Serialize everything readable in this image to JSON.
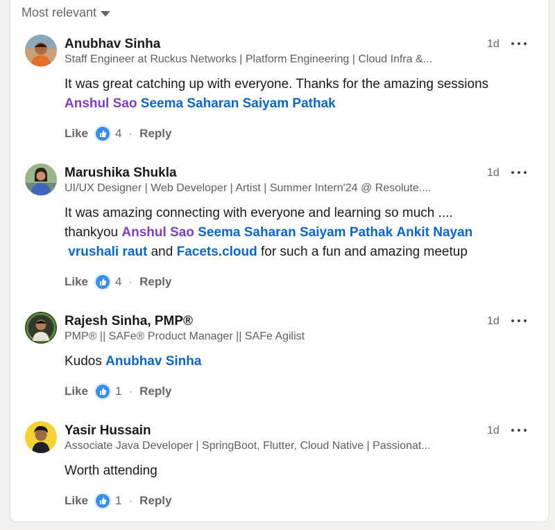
{
  "sort": {
    "label": "Most relevant"
  },
  "comments": [
    {
      "name": "Anubhav Sinha",
      "headline": "Staff Engineer at Ruckus Networks | Platform Engineering | Cloud Infra &...",
      "time": "1d",
      "text_1": "It was great catching up with everyone. Thanks for the amazing sessions",
      "mentions": [
        "Anshul Sao",
        "Seema Saharan",
        "Saiyam Pathak"
      ],
      "like_label": "Like",
      "reactions": "4",
      "reply_label": "Reply"
    },
    {
      "name": "Marushika Shukla",
      "headline": "UI/UX Designer | Web Developer | Artist | Summer Intern'24 @ Resolute....",
      "time": "1d",
      "text_1": "It was amazing connecting with everyone and learning so much ....",
      "text_2": "thankyou",
      "mentions": [
        "Anshul Sao",
        "Seema Saharan",
        "Saiyam Pathak",
        "Ankit Nayan",
        "vrushali raut",
        "Facets.cloud"
      ],
      "text_and": "and",
      "text_3": "for such a fun and amazing meetup",
      "like_label": "Like",
      "reactions": "4",
      "reply_label": "Reply"
    },
    {
      "name": "Rajesh Sinha, PMP®",
      "headline": "PMP® || SAFe® Product Manager || SAFe Agilist",
      "time": "1d",
      "text_1": "Kudos",
      "mentions": [
        "Anubhav Sinha"
      ],
      "like_label": "Like",
      "reactions": "1",
      "reply_label": "Reply"
    },
    {
      "name": "Yasir Hussain",
      "headline": "Associate Java Developer | SpringBoot, Flutter, Cloud Native | Passionat...",
      "time": "1d",
      "text_1": "Worth attending",
      "like_label": "Like",
      "reactions": "1",
      "reply_label": "Reply"
    }
  ],
  "colors": {
    "mention_blue": "#0a66c2",
    "mention_purple": "#7c3fc0",
    "like_blue": "#378fe9"
  },
  "icons": {
    "reaction": "thumbs-up-icon",
    "more": "more-options-icon",
    "sort": "caret-down-icon"
  }
}
